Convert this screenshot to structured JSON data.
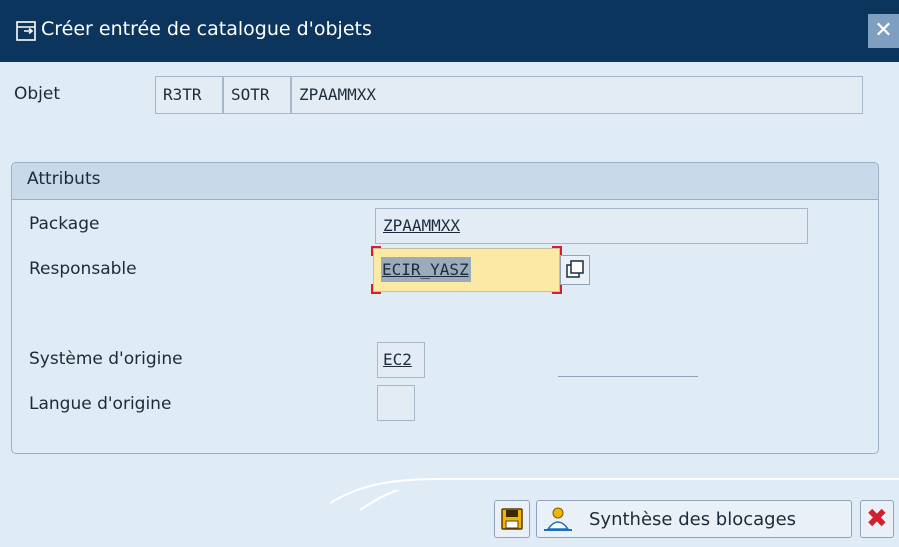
{
  "window": {
    "title": "Créer entrée de catalogue d'objets",
    "close_icon": "close-icon"
  },
  "object_row": {
    "label": "Objet",
    "pgmid": "R3TR",
    "object_type": "SOTR",
    "object_name": "ZPAAMMXX"
  },
  "attributes": {
    "title": "Attributs",
    "package_label": "Package",
    "package_value": "ZPAAMMXX",
    "responsible_label": "Responsable",
    "responsible_value": "ECIR_YASZ",
    "source_system_label": "Système d'origine",
    "source_system_value": "EC2",
    "source_system_description": "",
    "original_language_label": "Langue d'origine",
    "original_language_value": ""
  },
  "toolbar": {
    "save_icon": "save-icon",
    "lock_overview_label": "Synthèse des blocages",
    "lock_overview_icon": "person-icon",
    "cancel_icon": "cancel-icon"
  },
  "colors": {
    "title_bar": "#0c355e",
    "background": "#dfebf5",
    "focused_field": "#fce9a4",
    "cancel_red": "#d2202f"
  }
}
